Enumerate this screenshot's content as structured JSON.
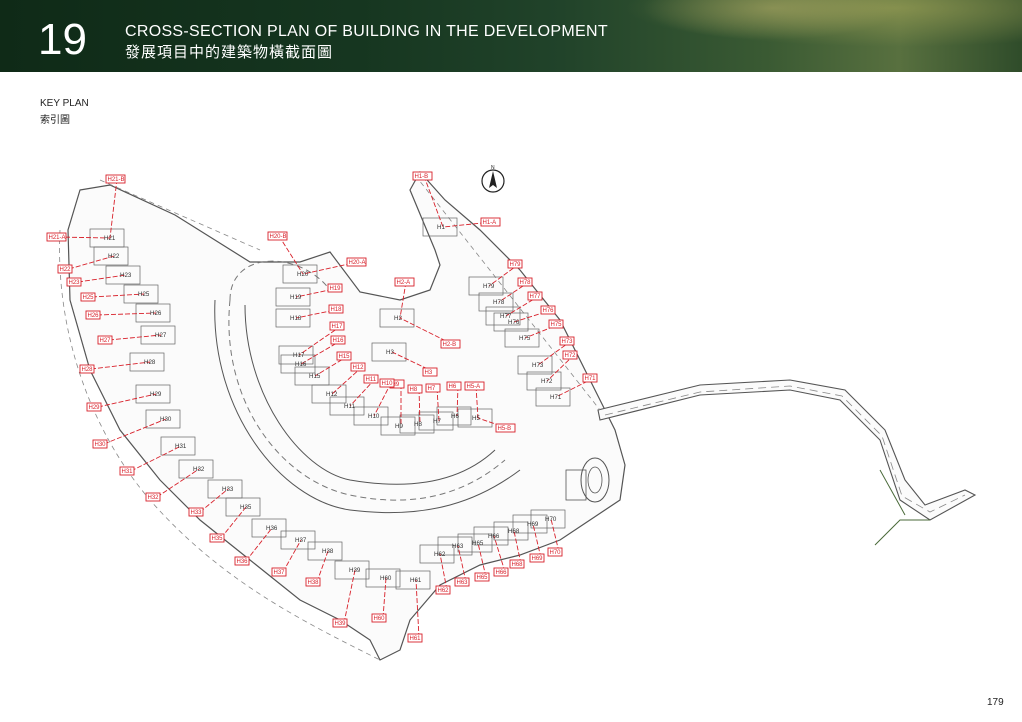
{
  "header": {
    "section_number": "19",
    "title_en": "CROSS-SECTION PLAN OF BUILDING IN THE DEVELOPMENT",
    "title_zh": "發展項目中的建築物橫截面圖"
  },
  "key_plan": {
    "label_en": "KEY PLAN",
    "label_zh": "索引圖"
  },
  "north_symbol": "N",
  "house_labels": [
    "H1",
    "H2",
    "H3",
    "H5",
    "H6",
    "H7",
    "H8",
    "H9",
    "H10",
    "H11",
    "H12",
    "H15",
    "H16",
    "H17",
    "H18",
    "H19",
    "H20",
    "H21",
    "H22",
    "H23",
    "H25",
    "H26",
    "H27",
    "H28",
    "H29",
    "H30",
    "H31",
    "H32",
    "H33",
    "H35",
    "H36",
    "H37",
    "H38",
    "H39",
    "H60",
    "H61",
    "H62",
    "H63",
    "H65",
    "H66",
    "H68",
    "H69",
    "H70",
    "H71",
    "H72",
    "H73",
    "H75",
    "H76",
    "H77",
    "H78",
    "H79"
  ],
  "section_tags": [
    "H1-B",
    "H1-A",
    "H2-A",
    "H2-B",
    "H3",
    "H5-A",
    "H5-B",
    "H6",
    "H7",
    "H8",
    "H9",
    "H10",
    "H11",
    "H12",
    "H15",
    "H16",
    "H17",
    "H18",
    "H19",
    "H20-A",
    "H20-B",
    "H21-A",
    "H21-B",
    "H22",
    "H23",
    "H25",
    "H26",
    "H27",
    "H28",
    "H29",
    "H30",
    "H31",
    "H32",
    "H33",
    "H35",
    "H36",
    "H37",
    "H38",
    "H39",
    "H60",
    "H61",
    "H62",
    "H63",
    "H65",
    "H66",
    "H68",
    "H69",
    "H70",
    "H71",
    "H72",
    "H73",
    "H75",
    "H76",
    "H77",
    "H78",
    "H79"
  ],
  "page_number": "179"
}
